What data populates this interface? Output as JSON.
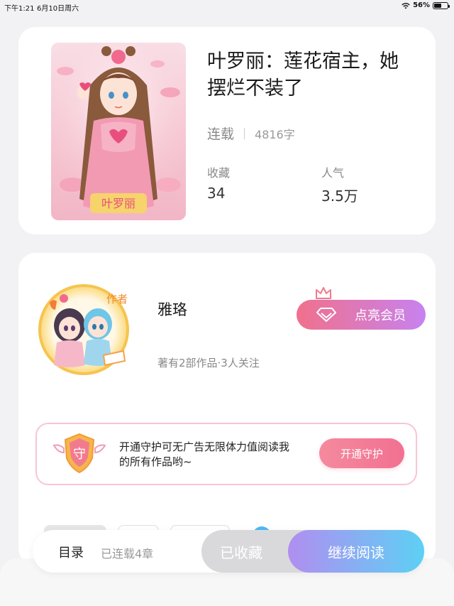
{
  "status_bar": {
    "time": "下午1:21",
    "date": "6月10日周六",
    "battery": "56%",
    "battery_level": 0.56
  },
  "book": {
    "title": "叶罗丽：莲花宿主，她摆烂不装了",
    "status": "连载",
    "word_count": "4816字",
    "collect_label": "收藏",
    "collect_value": "34",
    "popularity_label": "人气",
    "popularity_value": "3.5万",
    "cover_badge": "作者",
    "cover_logo_text": "叶罗丽"
  },
  "author": {
    "name": "雅珞",
    "works_info": "著有2部作品·3人关注",
    "avatar_badge": "作者",
    "vip_button": "点亮会员"
  },
  "guard": {
    "icon_char": "守",
    "text": "开通守护可无广告无限体力值阅读我的所有作品哟~",
    "button": "开通守护"
  },
  "bottom_bar": {
    "toc_label": "目录",
    "toc_sub": "已连载4章",
    "collected_button": "已收藏",
    "read_button": "继续阅读"
  },
  "colors": {
    "vip_gradient_start": "#f0718b",
    "vip_gradient_end": "#c782f0",
    "read_gradient_start": "#b18ef0",
    "read_gradient_end": "#5dd0f5",
    "guard_button": "#f27091"
  }
}
